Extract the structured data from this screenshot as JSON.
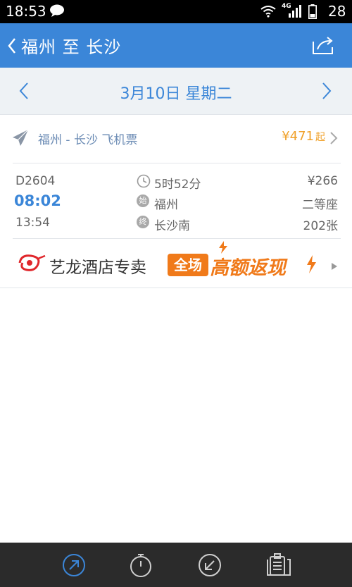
{
  "status_bar": {
    "time": "18:53",
    "network_label": "4G",
    "battery": "28",
    "icons": [
      "message-icon",
      "wifi-icon",
      "signal-icon",
      "battery-icon"
    ]
  },
  "title_bar": {
    "title": "福州 至 长沙",
    "back_icon": "chevron-left-icon",
    "share_icon": "share-icon"
  },
  "date_bar": {
    "date": "3月10日 星期二",
    "prev_icon": "chevron-left-icon",
    "next_icon": "chevron-right-icon"
  },
  "flight": {
    "label": "福州 - 长沙 飞机票",
    "price": "¥471",
    "suffix": "起"
  },
  "train": {
    "code": "D2604",
    "depart_time": "08:02",
    "arrive_time": "13:54",
    "duration": "5时52分",
    "start_badge": "始",
    "from": "福州",
    "end_badge": "终",
    "to": "长沙南",
    "price": "¥266",
    "seat_class": "二等座",
    "count": "202张"
  },
  "ad": {
    "brand": "艺龙酒店专卖",
    "promo_box": "全场",
    "promo_text": "高额返现"
  },
  "bottom_nav": {
    "items": [
      "depart-icon",
      "timer-icon",
      "arrive-icon",
      "clipboard-icon"
    ]
  },
  "colors": {
    "primary": "#3b86d8",
    "accent": "#f0a12a",
    "promo": "#f07a1a",
    "statusbar": "#000000",
    "bottom_nav": "#2b2b2b"
  }
}
